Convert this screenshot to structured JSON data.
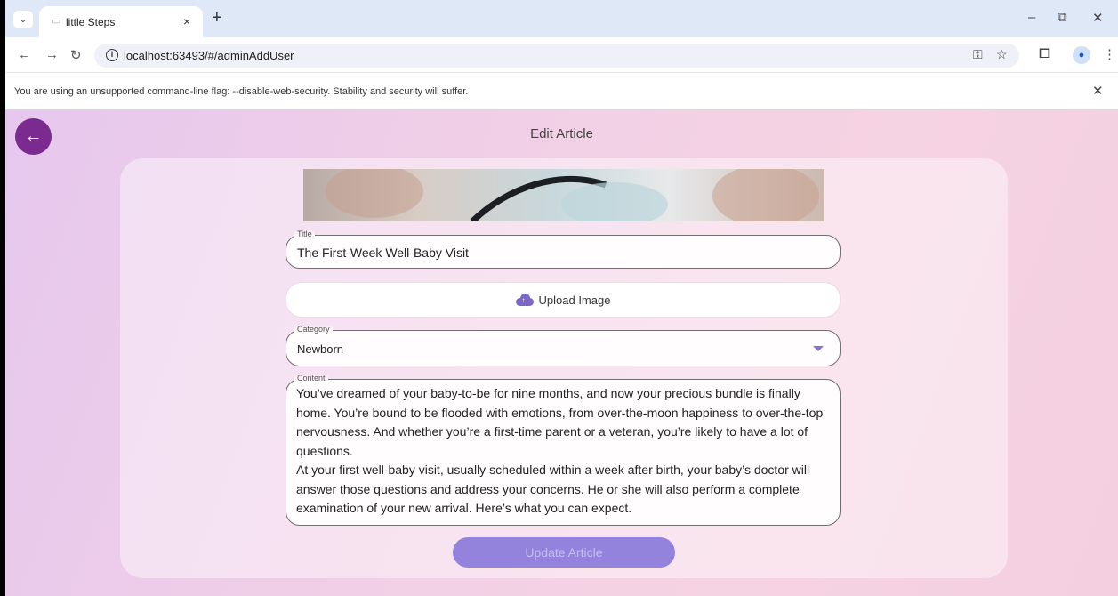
{
  "browser": {
    "tab_title": "little Steps",
    "tab_close": "×",
    "new_tab": "+",
    "url": "localhost:63493/#/adminAddUser",
    "infobar_text": "You are using an unsupported command-line flag: --disable-web-security. Stability and security will suffer."
  },
  "page": {
    "title": "Edit Article",
    "form": {
      "title_label": "Title",
      "title_value": "The First-Week Well-Baby Visit",
      "upload_label": "Upload Image",
      "category_label": "Category",
      "category_value": "Newborn",
      "content_label": "Content",
      "content_value": "You’ve dreamed of your baby-to-be for nine months, and now your precious bundle is finally home. You’re bound to be flooded with emotions, from over-the-moon happiness to over-the-top nervousness. And whether you’re a first-time parent or a veteran, you’re likely to have a lot of questions.\n At your first well-baby visit, usually scheduled within a week after birth, your baby’s doctor will answer those questions and address your concerns. He or she will also perform a complete examination of your new arrival. Here’s what you can expect.",
      "submit_label": "Update Article"
    }
  },
  "colors": {
    "accent": "#7b2a8f",
    "button": "#9383dd",
    "dropdown": "#8a70d3"
  },
  "icons": [
    "chevron-down-icon",
    "favicon-icon",
    "close-icon",
    "plus-icon",
    "minimize-icon",
    "restore-icon",
    "back-icon",
    "forward-icon",
    "reload-icon",
    "info-icon",
    "key-icon",
    "star-icon",
    "extensions-icon",
    "profile-icon",
    "more-icon",
    "arrow-left-icon",
    "cloud-upload-icon",
    "dropdown-arrow-icon"
  ]
}
